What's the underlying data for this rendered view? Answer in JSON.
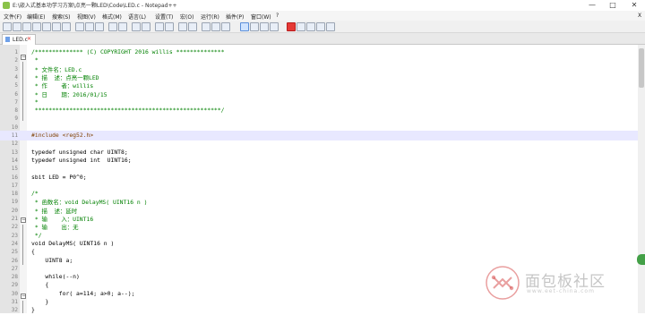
{
  "window": {
    "title": "E:\\嵌入式基本功学习方案\\点亮一颗LED\\Code\\LED.c - Notepad++",
    "controls": {
      "minimize": "—",
      "maximize": "□",
      "close": "✕"
    }
  },
  "menu": [
    "文件(F)",
    "编辑(E)",
    "搜索(S)",
    "视图(V)",
    "格式(M)",
    "语言(L)",
    "设置(T)",
    "宏(O)",
    "运行(R)",
    "插件(P)",
    "窗口(W)",
    "?"
  ],
  "menu_close": "X",
  "tab": {
    "label": "LED.c",
    "close": "✕"
  },
  "editor": {
    "lines": [
      {
        "n": "1",
        "text": "/************** (C) COPYRIGHT 2016 willis **************",
        "style": "comment"
      },
      {
        "n": "2",
        "text": " *",
        "style": "comment"
      },
      {
        "n": "3",
        "text": " * 文件名：LED.c",
        "style": "comment"
      },
      {
        "n": "4",
        "text": " * 描  述：点亮一颗LED",
        "style": "comment"
      },
      {
        "n": "5",
        "text": " * 作    者：willis",
        "style": "comment"
      },
      {
        "n": "6",
        "text": " * 日    期：2016/01/15",
        "style": "comment"
      },
      {
        "n": "7",
        "text": " *",
        "style": "comment"
      },
      {
        "n": "8",
        "text": " ******************************************************/",
        "style": "comment"
      },
      {
        "n": "9",
        "text": "",
        "style": "normal"
      },
      {
        "n": "10",
        "text": "",
        "style": "normal"
      },
      {
        "n": "11",
        "text": "#include <reg52.h>",
        "style": "preproc"
      },
      {
        "n": "12",
        "text": "",
        "style": "normal"
      },
      {
        "n": "13",
        "text": "typedef unsigned char UINT8;",
        "style": "normal"
      },
      {
        "n": "14",
        "text": "typedef unsigned int  UINT16;",
        "style": "normal"
      },
      {
        "n": "15",
        "text": "",
        "style": "normal"
      },
      {
        "n": "16",
        "text": "sbit LED = P0^0;",
        "style": "normal"
      },
      {
        "n": "17",
        "text": "",
        "style": "normal"
      },
      {
        "n": "18",
        "text": "/*",
        "style": "comment"
      },
      {
        "n": "19",
        "text": " * 函数名：void DelayMS( UINT16 n )",
        "style": "comment"
      },
      {
        "n": "20",
        "text": " * 描  述：延时",
        "style": "comment"
      },
      {
        "n": "21",
        "text": " * 输    入：UINT16",
        "style": "comment"
      },
      {
        "n": "22",
        "text": " * 输    出：无",
        "style": "comment"
      },
      {
        "n": "23",
        "text": " */",
        "style": "comment"
      },
      {
        "n": "24",
        "text": "void DelayMS( UINT16 n )",
        "style": "normal"
      },
      {
        "n": "25",
        "text": "{",
        "style": "normal"
      },
      {
        "n": "26",
        "text": "    UINT8 a;",
        "style": "normal"
      },
      {
        "n": "27",
        "text": "",
        "style": "normal"
      },
      {
        "n": "28",
        "text": "    while(--n)",
        "style": "normal"
      },
      {
        "n": "29",
        "text": "    {",
        "style": "normal"
      },
      {
        "n": "30",
        "text": "        for( a=114; a>0; a--);",
        "style": "normal"
      },
      {
        "n": "31",
        "text": "    }",
        "style": "normal"
      },
      {
        "n": "32",
        "text": "}",
        "style": "normal"
      }
    ]
  },
  "watermark": {
    "text": "面包板社区",
    "sub": "www.eet-china.com"
  },
  "colors": {
    "comment": "#008000",
    "number": "#ff8000",
    "keyword": "#1a1a8c",
    "current_line": "#e8e8ff"
  }
}
